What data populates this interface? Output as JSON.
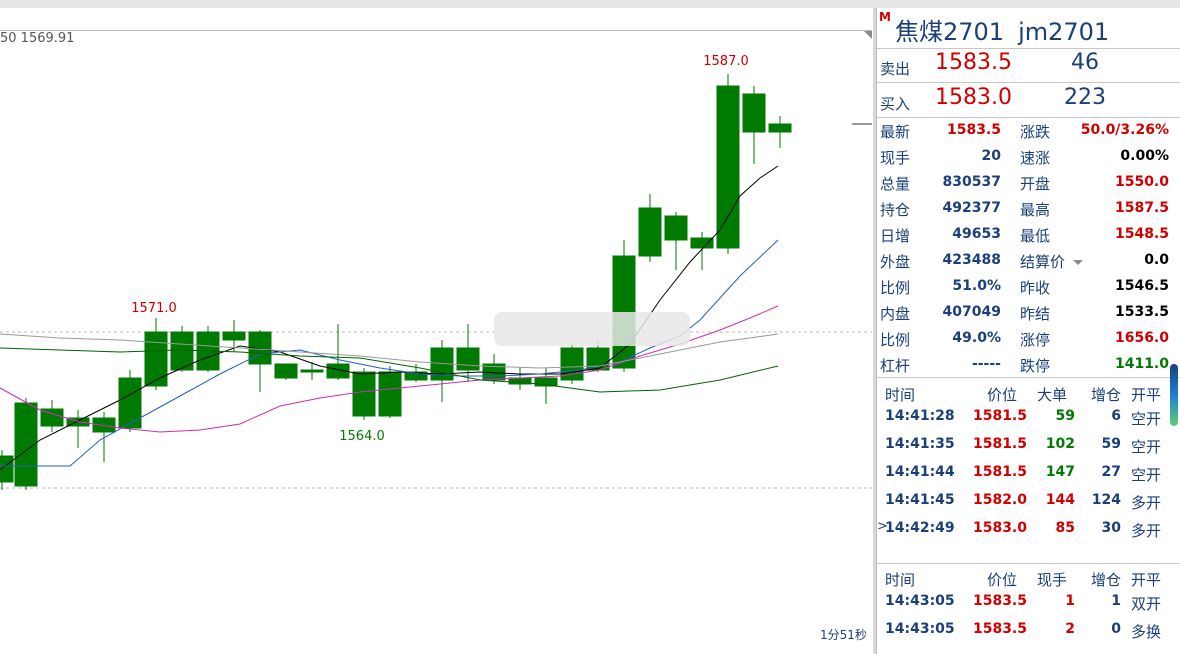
{
  "ma_readout": "50 1569.91",
  "timer": "1分51秒",
  "chart_data": {
    "type": "candlestick",
    "annotations": [
      {
        "text": "1587.0",
        "color": "#d00000"
      },
      {
        "text": "1571.0",
        "color": "#d00000"
      },
      {
        "text": "1564.0",
        "color": "#007a00"
      }
    ]
  },
  "quote": {
    "title": "焦煤2701",
    "code": "jm2701",
    "ask_label": "卖出",
    "ask_price": "1583.5",
    "ask_vol": "46",
    "bid_label": "买入",
    "bid_price": "1583.0",
    "bid_vol": "223"
  },
  "stats": {
    "left": [
      {
        "k": "最新",
        "v": "1583.5",
        "c": "red"
      },
      {
        "k": "现手",
        "v": "20",
        "c": "blue"
      },
      {
        "k": "总量",
        "v": "830537",
        "c": "blue"
      },
      {
        "k": "持仓",
        "v": "492377",
        "c": "blue"
      },
      {
        "k": "日增",
        "v": "49653",
        "c": "blue"
      },
      {
        "k": "外盘",
        "v": "423488",
        "c": "blue"
      },
      {
        "k": "比例",
        "v": "51.0%",
        "c": "blue"
      },
      {
        "k": "内盘",
        "v": "407049",
        "c": "blue"
      },
      {
        "k": "比例",
        "v": "49.0%",
        "c": "blue"
      },
      {
        "k": "杠杆",
        "v": "-----",
        "c": "blue"
      }
    ],
    "right": [
      {
        "k": "涨跌",
        "v": "50.0/3.26%",
        "c": "red"
      },
      {
        "k": "速涨",
        "v": "0.00%",
        "c": "black"
      },
      {
        "k": "开盘",
        "v": "1550.0",
        "c": "red"
      },
      {
        "k": "最高",
        "v": "1587.5",
        "c": "red"
      },
      {
        "k": "最低",
        "v": "1548.5",
        "c": "red"
      },
      {
        "k": "结算价",
        "v": "0.0",
        "c": "black"
      },
      {
        "k": "昨收",
        "v": "1546.5",
        "c": "black"
      },
      {
        "k": "昨结",
        "v": "1533.5",
        "c": "black"
      },
      {
        "k": "涨停",
        "v": "1656.0",
        "c": "red"
      },
      {
        "k": "跌停",
        "v": "1411.0",
        "c": "green"
      }
    ]
  },
  "ticks_big": {
    "headers": [
      "时间",
      "价位",
      "大单",
      "增仓",
      "开平"
    ],
    "rows": [
      {
        "t": "14:41:28",
        "p": "1581.5",
        "b": "59",
        "bc": "green",
        "z": "6",
        "o": "空开"
      },
      {
        "t": "14:41:35",
        "p": "1581.5",
        "b": "102",
        "bc": "green",
        "z": "59",
        "o": "空开"
      },
      {
        "t": "14:41:44",
        "p": "1581.5",
        "b": "147",
        "bc": "green",
        "z": "27",
        "o": "空开"
      },
      {
        "t": "14:41:45",
        "p": "1582.0",
        "b": "144",
        "bc": "red",
        "z": "124",
        "o": "多开"
      },
      {
        "t": "14:42:49",
        "p": "1583.0",
        "b": "85",
        "bc": "red",
        "z": "30",
        "o": "多开"
      }
    ]
  },
  "ticks": {
    "headers": [
      "时间",
      "价位",
      "现手",
      "增仓",
      "开平"
    ],
    "rows": [
      {
        "t": "14:43:05",
        "p": "1583.5",
        "b": "1",
        "bc": "red",
        "z": "1",
        "o": "双开"
      },
      {
        "t": "14:43:05",
        "p": "1583.5",
        "b": "2",
        "bc": "red",
        "z": "0",
        "o": "多换"
      }
    ]
  }
}
